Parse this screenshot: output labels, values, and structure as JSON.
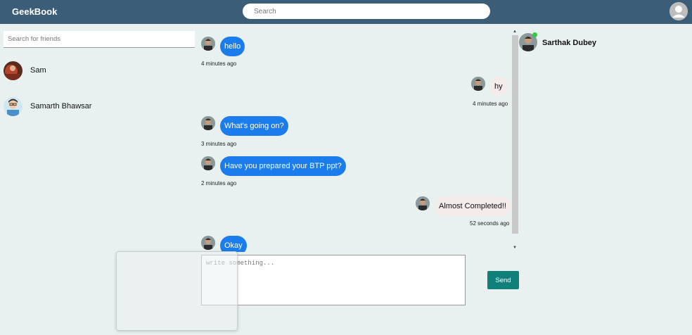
{
  "header": {
    "logo": "GeekBook",
    "search_placeholder": "Search"
  },
  "friends_panel": {
    "search_placeholder": "Search for friends",
    "friends": [
      {
        "name": "Sam"
      },
      {
        "name": "Samarth Bhawsar"
      }
    ]
  },
  "chat": {
    "messages": [
      {
        "direction": "in",
        "text": "hello",
        "time": "4 minutes ago"
      },
      {
        "direction": "out",
        "text": "hy",
        "time": "4 minutes ago"
      },
      {
        "direction": "in",
        "text": "What's going on?",
        "time": "3 minutes ago"
      },
      {
        "direction": "in",
        "text": "Have you prepared your BTP ppt?",
        "time": "2 minutes ago"
      },
      {
        "direction": "out",
        "text": "Almost Completed!!",
        "time": "52 seconds ago"
      },
      {
        "direction": "in",
        "text": "Okay",
        "time": ""
      }
    ],
    "input_placeholder": "write something...",
    "send_label": "Send"
  },
  "contact": {
    "name": "Sarthak Dubey",
    "status": "online"
  },
  "colors": {
    "topbar": "#3b5d78",
    "incoming_bubble": "#1b7cec",
    "outgoing_bubble": "#f3ecea",
    "send_button": "#12807a",
    "background": "#e8f0f0",
    "online_dot": "#2ecc40"
  }
}
